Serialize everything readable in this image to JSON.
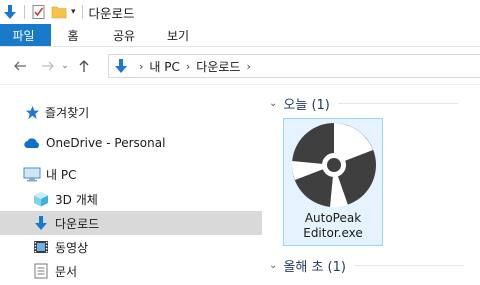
{
  "window": {
    "title": "다운로드"
  },
  "ribbon": {
    "file_tab": "파일",
    "tabs": [
      "홈",
      "공유",
      "보기"
    ]
  },
  "address": {
    "path": [
      "내 PC",
      "다운로드"
    ]
  },
  "sidebar": {
    "quick_access": "즐겨찾기",
    "onedrive": "OneDrive - Personal",
    "this_pc": "내 PC",
    "items": [
      {
        "label": "3D 개체",
        "icon": "cube-icon"
      },
      {
        "label": "다운로드",
        "icon": "download-arrow-icon",
        "selected": true
      },
      {
        "label": "동영상",
        "icon": "film-icon"
      },
      {
        "label": "문서",
        "icon": "document-icon"
      }
    ]
  },
  "groups": {
    "today": {
      "label": "오늘 (1)"
    },
    "this_year": {
      "label": "올해 초 (1)"
    }
  },
  "files": [
    {
      "name_line1": "AutoPeak",
      "name_line2": "Editor.exe",
      "icon": "disc-icon"
    }
  ],
  "colors": {
    "accent": "#1979ca",
    "selection": "#d9d9d9",
    "tile_hover": "#e5f3ff",
    "tile_border": "#99d1ff"
  }
}
